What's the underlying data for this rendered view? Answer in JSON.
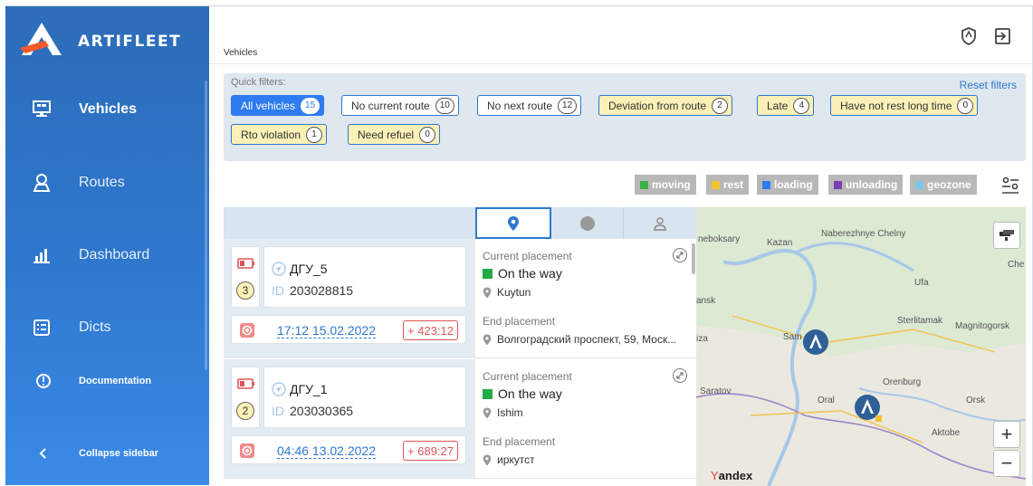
{
  "brand": {
    "name": "ARTIFLEET"
  },
  "sidebar": {
    "items": [
      {
        "label": "Vehicles"
      },
      {
        "label": "Routes"
      },
      {
        "label": "Dashboard"
      },
      {
        "label": "Dicts"
      },
      {
        "label": "Documentation"
      },
      {
        "label": "Collapse sidebar"
      }
    ]
  },
  "header": {
    "title": "Vehicles"
  },
  "filters": {
    "title": "Quick filters:",
    "reset_label": "Reset filters",
    "chips": [
      {
        "label": "All vehicles",
        "count": "15"
      },
      {
        "label": "No current route",
        "count": "10"
      },
      {
        "label": "No next route",
        "count": "12"
      },
      {
        "label": "Deviation from route",
        "count": "2"
      },
      {
        "label": "Late",
        "count": "4"
      },
      {
        "label": "Have not rest long time",
        "count": "0"
      },
      {
        "label": "Rto violation",
        "count": "1"
      },
      {
        "label": "Need refuel",
        "count": "0"
      }
    ]
  },
  "legend": [
    {
      "label": "moving",
      "color": "#3bb34a"
    },
    {
      "label": "rest",
      "color": "#f2c230"
    },
    {
      "label": "loading",
      "color": "#2f7cf0"
    },
    {
      "label": "unloading",
      "color": "#7a3fb8"
    },
    {
      "label": "geozone",
      "color": "#7fc6e8"
    }
  ],
  "vehicles": [
    {
      "badge": "3",
      "name": "ДГУ_5",
      "id_label": "ID",
      "id": "203028815",
      "time": "17:12 15.02.2022",
      "delta": "+ 423:12",
      "current_title": "Current placement",
      "status": "On the way",
      "current_location": "Kuytun",
      "end_title": "End placement",
      "end_location": "Волгоградский проспект, 59, Моск..."
    },
    {
      "badge": "2",
      "name": "ДГУ_1",
      "id_label": "ID",
      "id": "203030365",
      "time": "04:46 13.02.2022",
      "delta": "+ 689:27",
      "current_title": "Current placement",
      "status": "On the way",
      "current_location": "Ishim",
      "end_title": "End placement",
      "end_location": "иркутст"
    }
  ],
  "map": {
    "labels": [
      "neboksary",
      "Kazan",
      "Naberezhnye Chelny",
      "Che",
      "Ufa",
      "ansk",
      "Sterlitamak",
      "Magnitogorsk",
      "Sam",
      "iza",
      "Orenburg",
      "Saratov",
      "Oral",
      "Orsk",
      "Aktobe"
    ],
    "zoom_in": "+",
    "zoom_out": "−",
    "attribution_first": "Y",
    "attribution_rest": "andex"
  }
}
